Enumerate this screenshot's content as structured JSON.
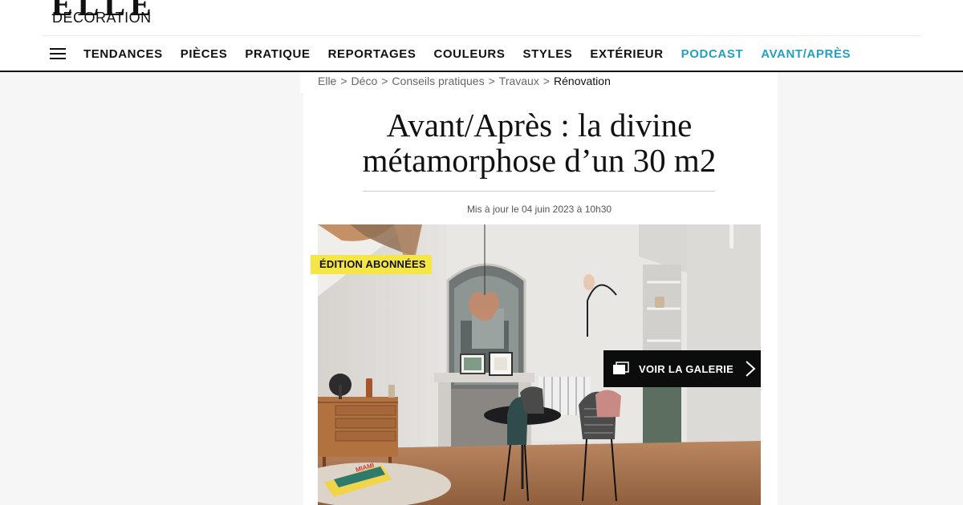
{
  "brand": {
    "logo_top": "ELLE",
    "logo_bottom": "DECORATION"
  },
  "nav": {
    "items": [
      {
        "label": "TENDANCES"
      },
      {
        "label": "PIÈCES"
      },
      {
        "label": "PRATIQUE"
      },
      {
        "label": "REPORTAGES"
      },
      {
        "label": "COULEURS"
      },
      {
        "label": "STYLES"
      },
      {
        "label": "EXTÉRIEUR"
      },
      {
        "label": "PODCAST"
      },
      {
        "label": "AVANT/APRÈS"
      }
    ],
    "accent_color": "#22a0bd"
  },
  "breadcrumb": {
    "items": [
      "Elle",
      "Déco",
      "Conseils pratiques",
      "Travaux"
    ],
    "current": "Rénovation",
    "separator": ">"
  },
  "article": {
    "title_line1": "Avant/Après : la divine",
    "title_line2": "métamorphose d’un 30 m2",
    "updated": "Mis à jour le 04 juin 2023 à 10h30"
  },
  "hero": {
    "badge": "ÉDITION ABONNÉES",
    "badge_color": "#f5e545",
    "gallery_label": "VOIR LA GALERIE",
    "book_text": "MIAMI"
  }
}
